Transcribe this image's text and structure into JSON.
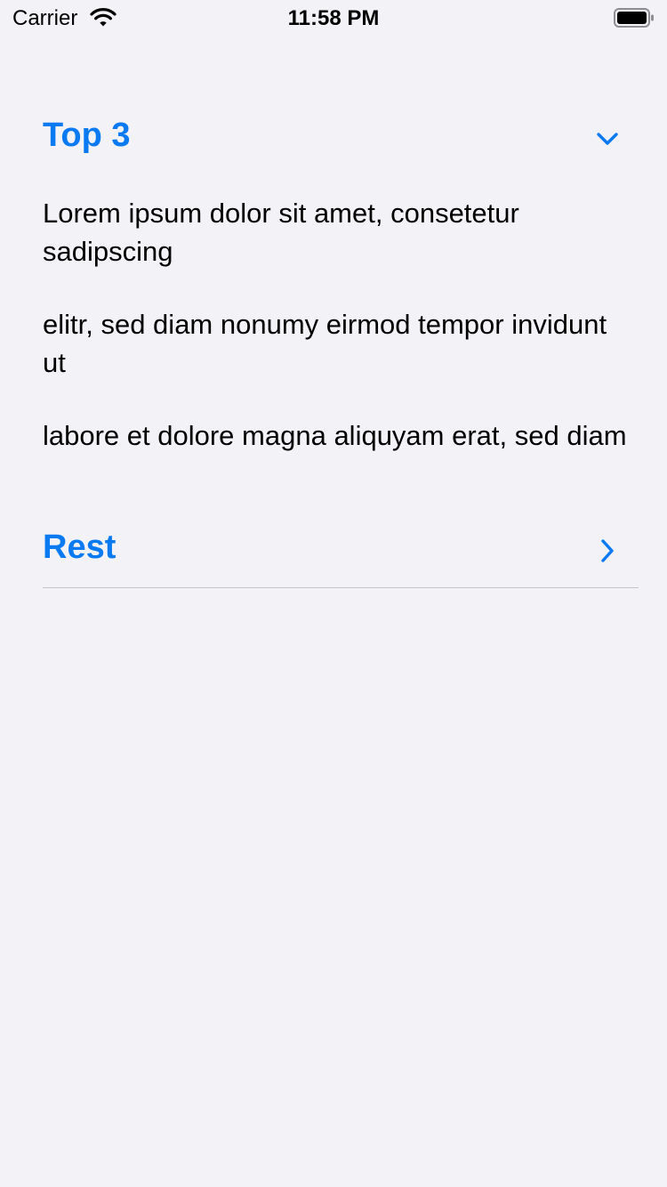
{
  "status_bar": {
    "carrier": "Carrier",
    "time": "11:58 PM",
    "icons": [
      "wifi-icon",
      "battery-icon"
    ]
  },
  "sections": [
    {
      "title": "Top 3",
      "expanded": true,
      "icon": "chevron-down-icon",
      "items": [
        "Lorem ipsum dolor sit amet, consetetur sadipscing",
        "elitr, sed diam nonumy eirmod tempor invidunt ut",
        "labore et dolore magna aliquyam erat, sed diam"
      ]
    },
    {
      "title": "Rest",
      "expanded": false,
      "icon": "chevron-right-icon"
    }
  ],
  "colors": {
    "background": "#f2f2f7",
    "accent": "#0a7af3",
    "text": "#000000",
    "separator": "#c6c6c8"
  }
}
